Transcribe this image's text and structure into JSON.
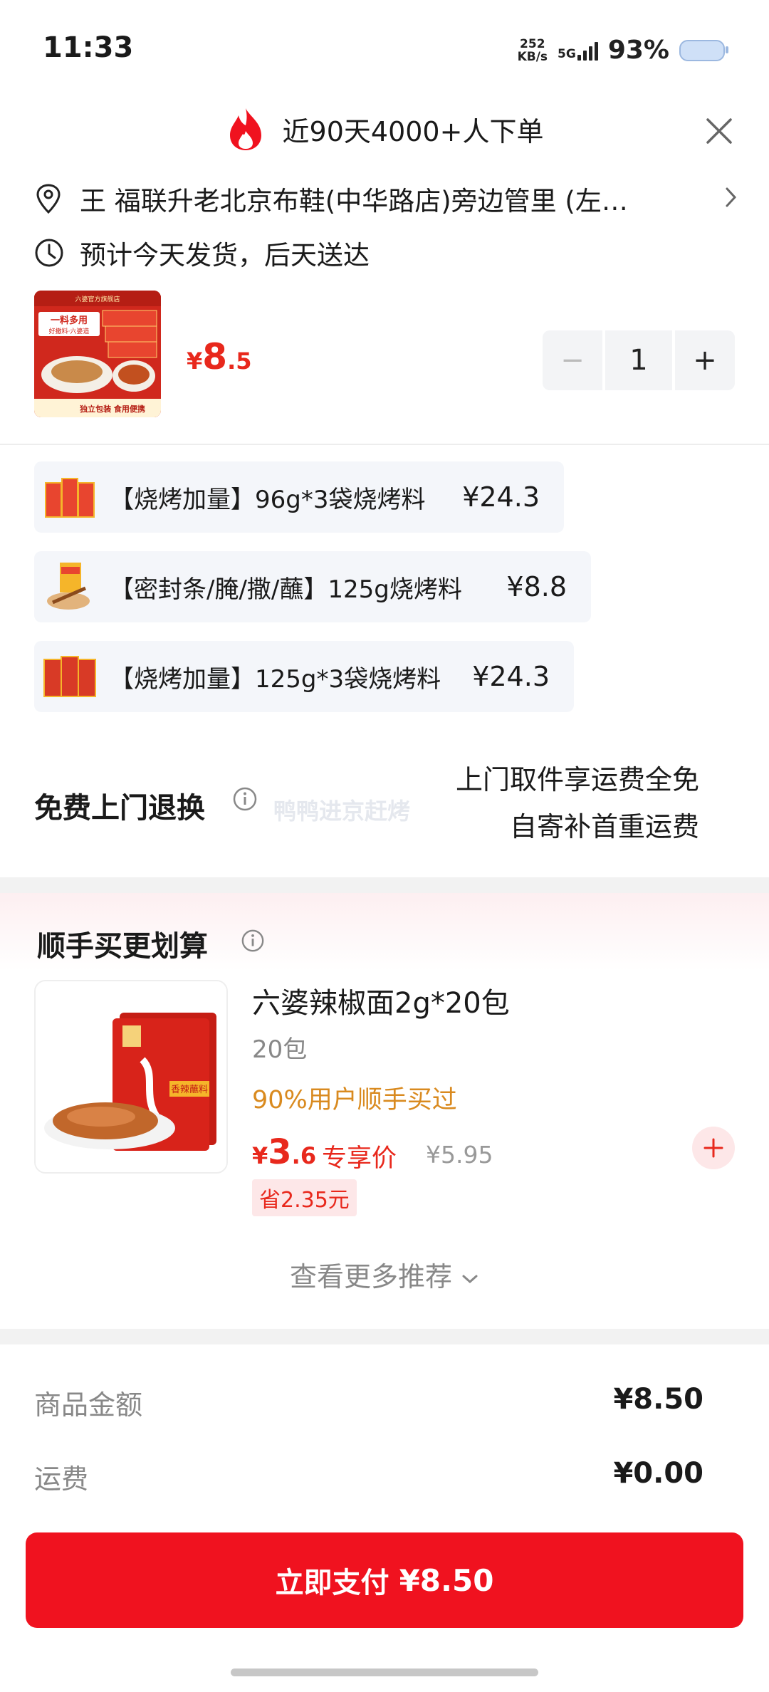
{
  "status_bar": {
    "time": "11:33",
    "net_speed_top": "252",
    "net_speed_unit": "KB/s",
    "network": "5G",
    "battery": "93%"
  },
  "header": {
    "hot_text": "近90天4000+人下单"
  },
  "address": {
    "text": "王  福联升老北京布鞋(中华路店)旁边管里 (左…"
  },
  "shipping": {
    "text": "预计今天发货，后天送达"
  },
  "product": {
    "currency": "¥",
    "price_int": "8",
    "price_dec": ".5",
    "quantity": "1",
    "minus": "−",
    "plus": "+",
    "thumb_labels": [
      "六婆官方旗舰店",
      "一料多用",
      "好撒料·六婆造",
      "独立包装 食用便携"
    ]
  },
  "variants": [
    {
      "name": "【烧烤加量】96g*3袋烧烤料",
      "price": "¥24.3"
    },
    {
      "name": "【密封条/腌/撒/蘸】125g烧烤料",
      "price": "¥8.8"
    },
    {
      "name": "【烧烤加量】125g*3袋烧烤料",
      "price": "¥24.3"
    }
  ],
  "returns": {
    "title": "免费上门退换",
    "line1": "上门取件享运费全免",
    "line2": "自寄补首重运费",
    "watermark": "鸭鸭进京赶烤"
  },
  "recommend": {
    "title": "顺手买更划算",
    "item_name": "六婆辣椒面2g*20包",
    "item_spec": "20包",
    "popularity": "90%用户顺手买过",
    "currency": "¥",
    "price_int": "3",
    "price_dec": ".6",
    "price_tag": "专享价",
    "orig_price": "¥5.95",
    "save": "省2.35元",
    "pack_label": "香辣蘸料",
    "more": "查看更多推荐"
  },
  "summary": {
    "goods_label": "商品金额",
    "goods_value": "¥8.50",
    "ship_label": "运费",
    "ship_value": "¥0.00"
  },
  "pay": {
    "label": "立即支付",
    "amount": "¥8.50"
  },
  "colors": {
    "accent": "#f0121f",
    "price_red": "#e8281c",
    "orange": "#d98a1f"
  }
}
